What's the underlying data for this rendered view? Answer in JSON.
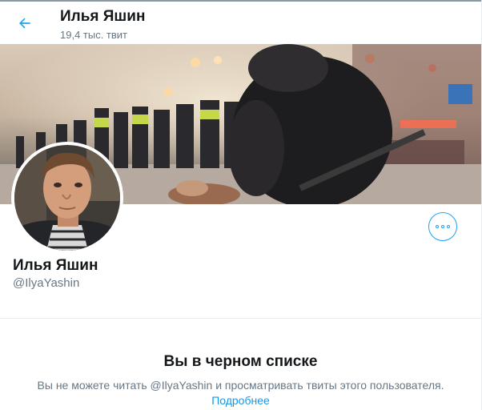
{
  "header": {
    "name": "Илья Яшин",
    "tweet_count": "19,4 тыс. твит",
    "back_icon": "arrow-left-icon"
  },
  "profile": {
    "display_name": "Илья Яшин",
    "handle": "@IlyaYashin",
    "more_icon": "ellipsis-icon"
  },
  "blocked": {
    "title": "Вы в черном списке",
    "description": "Вы не можете читать @IlyaYashin и просматривать твиты этого пользователя.",
    "learn_more": "Подробнее"
  },
  "colors": {
    "accent": "#1da1f2",
    "link": "#1b95e0",
    "secondary_text": "#657786",
    "primary_text": "#14171a"
  }
}
